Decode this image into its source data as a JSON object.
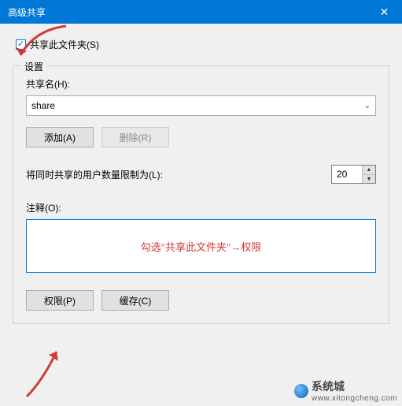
{
  "title": "高级共享",
  "checkbox": {
    "label": "共享此文件夹(S)",
    "checked": true
  },
  "fieldset": {
    "legend": "设置",
    "shareName": {
      "label": "共享名(H):",
      "value": "share"
    },
    "buttons": {
      "add": "添加(A)",
      "remove": "删除(R)"
    },
    "limit": {
      "label": "将同时共享的用户数量限制为(L):",
      "value": "20"
    },
    "comment": {
      "label": "注释(O):"
    },
    "actions": {
      "permissions": "权限(P)",
      "cache": "缓存(C)"
    }
  },
  "annotation": "勾选\"共享此文件夹\"→权限",
  "watermark": {
    "name": "系统城",
    "domain": "www.xitongcheng.com"
  }
}
